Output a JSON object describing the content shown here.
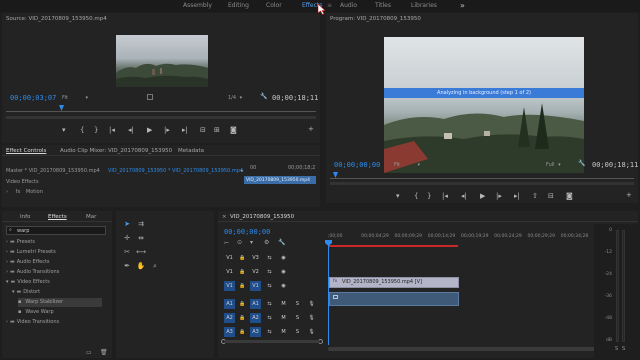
{
  "workspace": {
    "tabs": [
      "Assembly",
      "Editing",
      "Color",
      "Effects",
      "Audio",
      "Titles",
      "Libraries"
    ],
    "active": "Effects",
    "more": "»",
    "menu": "≡"
  },
  "source": {
    "title": "Source: VID_20170809_153950.mp4",
    "timecode": "00;00;03;07",
    "fit": "Fit",
    "resolution": "1/4",
    "duration": "00;00;18;11",
    "playhead_fraction": 0.17
  },
  "program": {
    "title": "Program: VID_20170809_153950",
    "timecode": "00;00;00;00",
    "fit": "Fit",
    "resolution": "Full",
    "duration": "00;00;18;11",
    "banner": "Analyzing in background (step 1 of 2)"
  },
  "effect_controls": {
    "tabs": [
      "Effect Controls",
      "Audio Clip Mixer: VID_20170809_153950",
      "Metadata"
    ],
    "master": "Master * VID_20170809_153950.mp4",
    "sequence": "VID_20170809_153950 * VID_20170809_153950.mp4",
    "section": "Video Effects",
    "motion": "Motion",
    "clip": "VID_20170809_153950.mp4",
    "times": [
      "00",
      "00;00;18;2"
    ]
  },
  "effects_panel": {
    "tabs": [
      "Info",
      "Effects",
      "Mar"
    ],
    "search": "warp",
    "tree": [
      {
        "label": "Presets",
        "depth": 0
      },
      {
        "label": "Lumetri Presets",
        "depth": 0
      },
      {
        "label": "Audio Effects",
        "depth": 0
      },
      {
        "label": "Audio Transitions",
        "depth": 0
      },
      {
        "label": "Video Effects",
        "depth": 0
      },
      {
        "label": "Distort",
        "depth": 1
      },
      {
        "label": "Warp Stabilizer",
        "depth": 2
      },
      {
        "label": "Wave Warp",
        "depth": 2
      },
      {
        "label": "Video Transitions",
        "depth": 0
      }
    ]
  },
  "timeline": {
    "tab": "VID_20170809_153950",
    "timecode": "00;00;00;00",
    "ruler": [
      ";00;00",
      "00;00;04;29",
      "00;00;09;29",
      "00;00;14;29",
      "00;00;19;29",
      "00;00;24;29",
      "00;00;29;29",
      "00;00;34;28"
    ],
    "tracks": [
      {
        "target": "V1",
        "name": "V3",
        "type": "video"
      },
      {
        "target": "V1",
        "name": "V2",
        "type": "video"
      },
      {
        "target": "V1",
        "name": "V1",
        "type": "video"
      },
      {
        "target": "A1",
        "name": "A1",
        "type": "audio"
      },
      {
        "target": "A2",
        "name": "A2",
        "type": "audio"
      },
      {
        "target": "A3",
        "name": "A3",
        "type": "audio"
      }
    ],
    "m_label": "M",
    "s_label": "S",
    "clip_label": "VID_20170809_153950.mp4 [V]",
    "clip_badge": "fx",
    "meter_labels": [
      "0",
      "-12",
      "-24",
      "-36",
      "-48",
      "dB"
    ]
  },
  "colors": {
    "accent": "#2d8ceb",
    "banner": "#3b7bd8",
    "clip_video": "#b4b4c8",
    "clip_audio": "#3f5a78",
    "track_on": "#1f4e8a",
    "render_bar": "#c82828"
  }
}
